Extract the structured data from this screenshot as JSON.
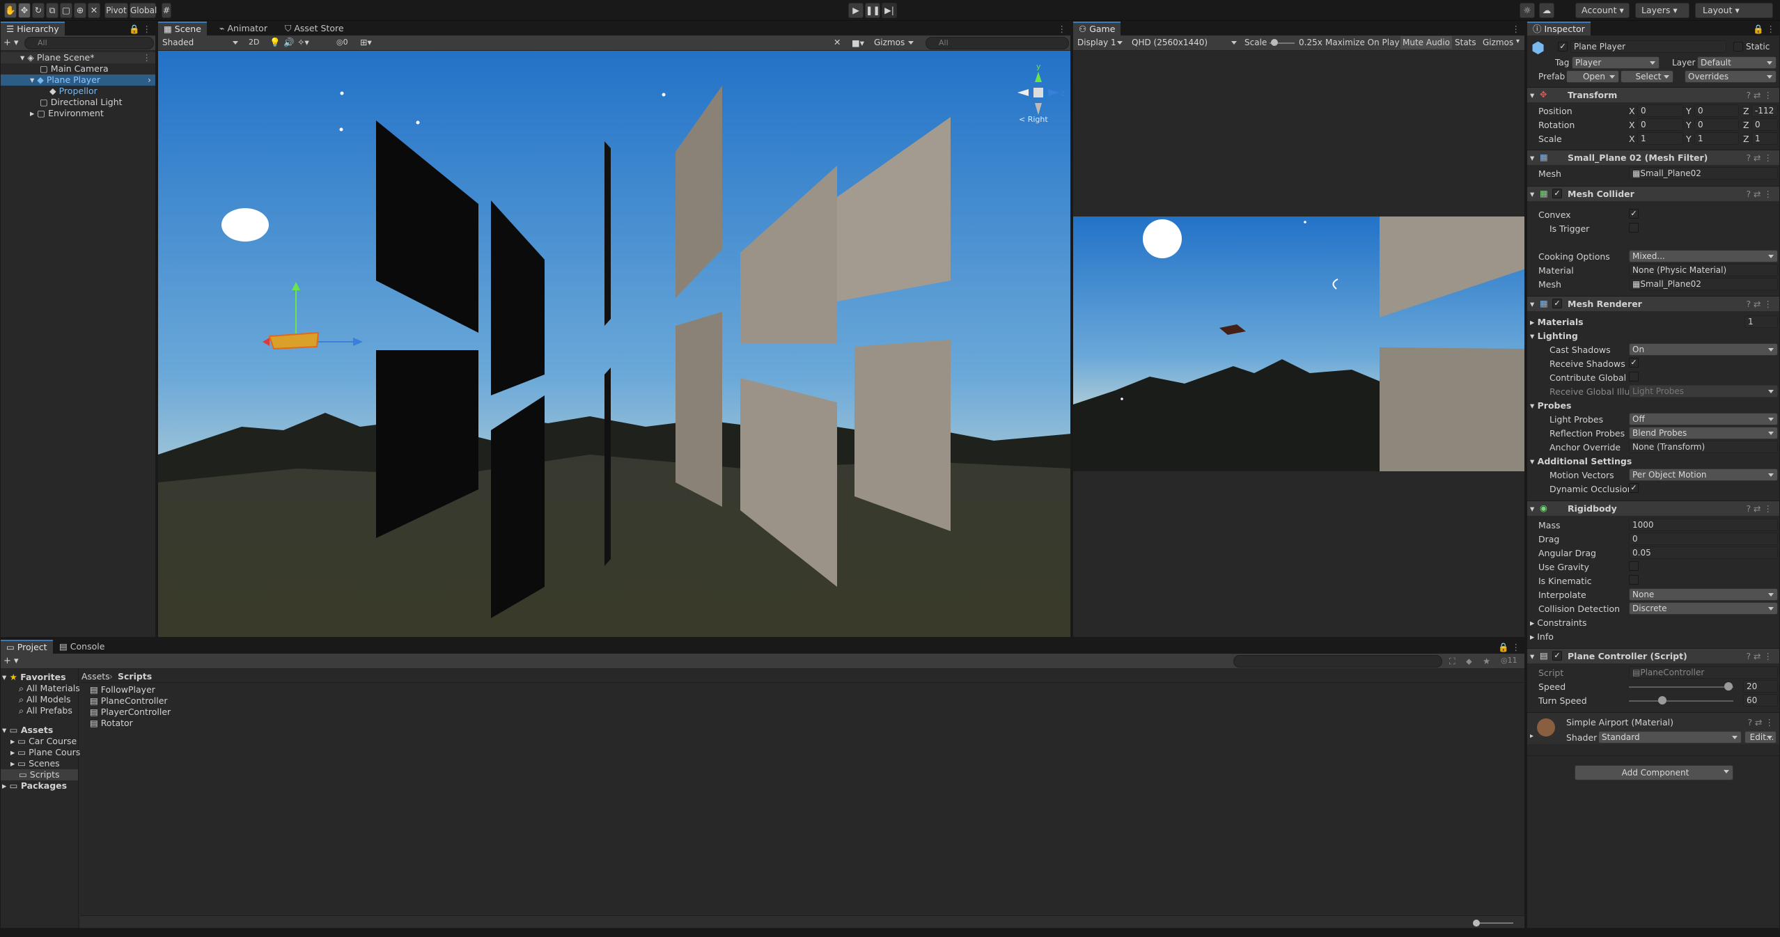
{
  "toolbar": {
    "pivot": "Pivot",
    "global": "Global",
    "account": "Account",
    "layers": "Layers",
    "layout": "Layout",
    "play_icon": "play-icon",
    "pause_icon": "pause-icon",
    "step_icon": "step-icon"
  },
  "hierarchy": {
    "tab": "Hierarchy",
    "search_placeholder": "All",
    "items": [
      {
        "label": "Plane Scene*",
        "icon": "unity-scene-icon"
      },
      {
        "label": "Main Camera",
        "icon": "gameobject-icon"
      },
      {
        "label": "Plane Player",
        "icon": "prefab-icon"
      },
      {
        "label": "Propellor",
        "icon": "prefab-icon"
      },
      {
        "label": "Directional Light",
        "icon": "gameobject-icon"
      },
      {
        "label": "Environment",
        "icon": "gameobject-icon"
      }
    ]
  },
  "scene": {
    "tabs": [
      "Scene",
      "Animator",
      "Asset Store"
    ],
    "shading": "Shaded",
    "mode2d": "2D",
    "gizmos": "Gizmos",
    "search_placeholder": "All",
    "vis_count": "0",
    "gizmo_view": "< Right",
    "axis_y": "y",
    "axis_z": "z"
  },
  "game": {
    "tab": "Game",
    "display": "Display 1",
    "resolution": "QHD (2560x1440)",
    "scale_label": "Scale",
    "scale_value": "0.25x",
    "maximize": "Maximize On Play",
    "mute": "Mute Audio",
    "stats": "Stats",
    "gizmos": "Gizmos"
  },
  "inspector": {
    "tab": "Inspector",
    "name": "Plane Player",
    "static": "Static",
    "tag_label": "Tag",
    "tag": "Player",
    "layer_label": "Layer",
    "layer": "Default",
    "prefab_label": "Prefab",
    "open": "Open",
    "select": "Select",
    "overrides": "Overrides",
    "transform": {
      "title": "Transform",
      "position": {
        "label": "Position",
        "x": "0",
        "y": "0",
        "z": "-112"
      },
      "rotation": {
        "label": "Rotation",
        "x": "0",
        "y": "0",
        "z": "0"
      },
      "scale": {
        "label": "Scale",
        "x": "1",
        "y": "1",
        "z": "1"
      }
    },
    "mesh_filter": {
      "title": "Small_Plane 02 (Mesh Filter)",
      "mesh_label": "Mesh",
      "mesh": "Small_Plane02"
    },
    "mesh_collider": {
      "title": "Mesh Collider",
      "convex": "Convex",
      "is_trigger": "Is Trigger",
      "cooking_label": "Cooking Options",
      "cooking": "Mixed...",
      "material_label": "Material",
      "material": "None (Physic Material)",
      "mesh_label": "Mesh",
      "mesh": "Small_Plane02"
    },
    "mesh_renderer": {
      "title": "Mesh Renderer",
      "materials": "Materials",
      "materials_count": "1",
      "lighting": "Lighting",
      "cast_shadows_label": "Cast Shadows",
      "cast_shadows": "On",
      "receive_shadows": "Receive Shadows",
      "contribute_gi": "Contribute Global Ill",
      "receive_gi_label": "Receive Global Illum",
      "receive_gi": "Light Probes",
      "probes": "Probes",
      "light_probes_label": "Light Probes",
      "light_probes": "Off",
      "reflection_label": "Reflection Probes",
      "reflection": "Blend Probes",
      "anchor_label": "Anchor Override",
      "anchor": "None (Transform)",
      "additional": "Additional Settings",
      "motion_label": "Motion Vectors",
      "motion": "Per Object Motion",
      "dynamic_occlusion": "Dynamic Occlusion"
    },
    "rigidbody": {
      "title": "Rigidbody",
      "mass_label": "Mass",
      "mass": "1000",
      "drag_label": "Drag",
      "drag": "0",
      "angular_label": "Angular Drag",
      "angular": "0.05",
      "gravity": "Use Gravity",
      "kinematic": "Is Kinematic",
      "interpolate_label": "Interpolate",
      "interpolate": "None",
      "collision_label": "Collision Detection",
      "collision": "Discrete",
      "constraints": "Constraints",
      "info": "Info"
    },
    "plane_controller": {
      "title": "Plane Controller (Script)",
      "script_label": "Script",
      "script": "PlaneController",
      "speed_label": "Speed",
      "speed": "20",
      "turn_label": "Turn Speed",
      "turn": "60",
      "speed_fraction": 0.95,
      "turn_fraction": 0.32
    },
    "material": {
      "title": "Simple Airport (Material)",
      "shader_label": "Shader",
      "shader": "Standard",
      "edit": "Edit..."
    },
    "add_component": "Add Component"
  },
  "project": {
    "tabs": [
      "Project",
      "Console"
    ],
    "favorites": "Favorites",
    "fav_items": [
      "All Materials",
      "All Models",
      "All Prefabs"
    ],
    "assets": "Assets",
    "asset_folders": [
      "Car Course",
      "Plane Cours",
      "Scenes",
      "Scripts"
    ],
    "packages": "Packages",
    "breadcrumb_root": "Assets",
    "breadcrumb_current": "Scripts",
    "files": [
      "FollowPlayer",
      "PlaneController",
      "PlayerController",
      "Rotator"
    ],
    "hidden_count": "11"
  },
  "colors": {
    "accent": "#3a79bb",
    "selection": "#2c5d87",
    "sky_top": "#2b7fd6",
    "sky_bottom": "#b6d0d6",
    "ground": "#2f2f24"
  }
}
